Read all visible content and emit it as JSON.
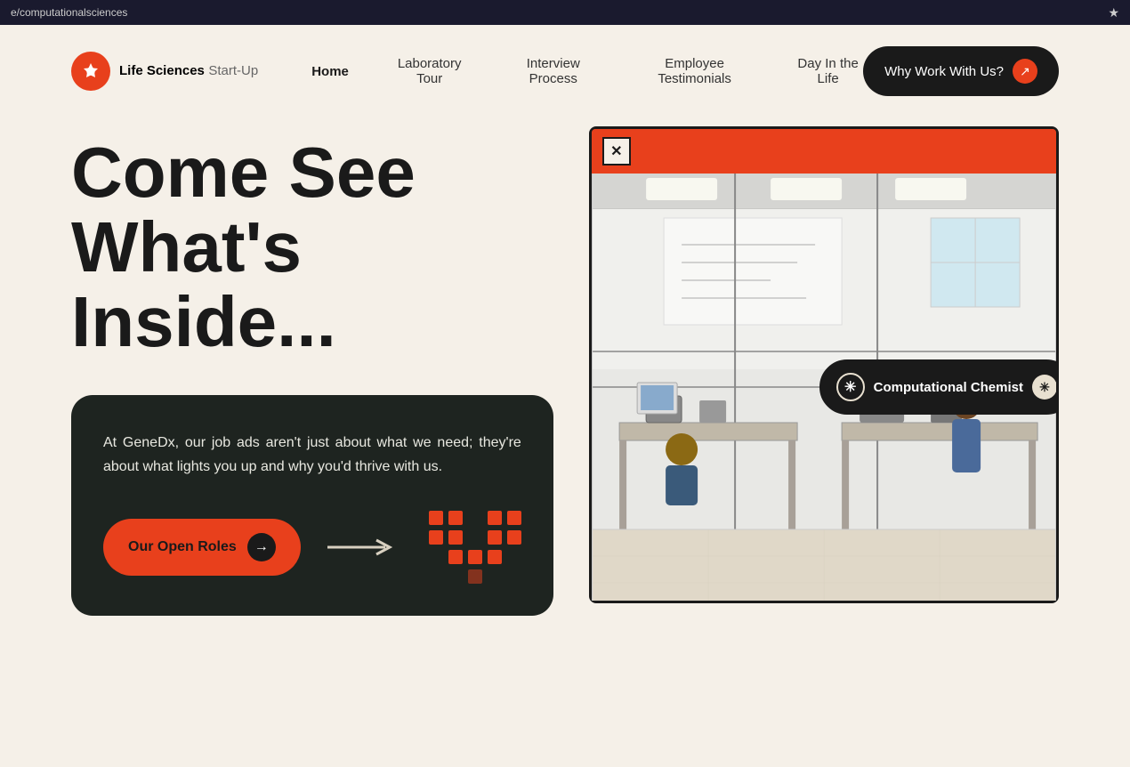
{
  "browser": {
    "url": "e/computationalsciences",
    "star_icon": "★"
  },
  "nav": {
    "logo_icon": "◈",
    "logo_brand": "Life Sciences",
    "logo_sub": "Start-Up",
    "home_label": "Home",
    "lab_tour_label": "Laboratory Tour",
    "interview_label": "Interview Process",
    "testimonials_label": "Employee Testimonials",
    "day_life_label": "Day In the Life",
    "cta_label": "Why Work With Us?",
    "cta_arrow": "↗"
  },
  "hero": {
    "title_line1": "Come See",
    "title_line2": "What's",
    "title_line3": "Inside...",
    "description": "At GeneDx, our job ads aren't just about what we need; they're about what lights you up and why you'd thrive with us.",
    "open_roles_label": "Our Open Roles",
    "arrow_label": "→",
    "close_btn": "✕"
  },
  "badge": {
    "label": "Computational Chemist",
    "left_star": "✳",
    "right_star": "✳"
  },
  "dot_grid": {
    "pattern": [
      [
        true,
        true,
        false,
        true,
        true
      ],
      [
        true,
        true,
        false,
        true,
        true
      ],
      [
        false,
        true,
        true,
        true,
        false
      ],
      [
        false,
        false,
        false,
        false,
        false
      ]
    ]
  }
}
